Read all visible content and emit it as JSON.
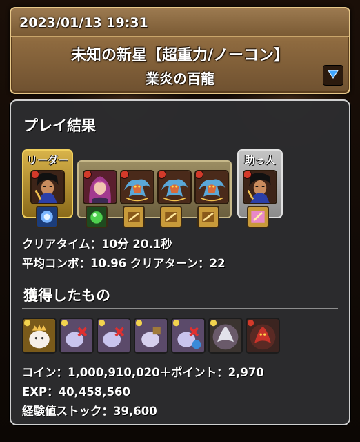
{
  "header": {
    "date": "2023/01/13 19:31",
    "title": "未知の新星【超重力/ノーコン】",
    "subtitle": "業炎の百龍",
    "expand_icon": "chevron-down-icon"
  },
  "play_result": {
    "heading": "プレイ結果",
    "leader_label": "リーダー",
    "helper_label": "助っ人",
    "team": [
      {
        "role": "leader",
        "icon": "monster-dark-warrior-icon",
        "attribute_color": "#d33a2a",
        "assist_icon": "assist-blue-beast-icon"
      },
      {
        "role": "sub",
        "icon": "monster-purple-hair-girl-icon",
        "attribute_color": "#d33a2a",
        "assist_icon": "assist-green-orb-icon"
      },
      {
        "role": "sub",
        "icon": "monster-dragon-icon",
        "attribute_color": "#d33a2a",
        "assist_icon": "assist-weapon-card-icon"
      },
      {
        "role": "sub",
        "icon": "monster-dragon-icon",
        "attribute_color": "#d33a2a",
        "assist_icon": "assist-weapon-card-icon"
      },
      {
        "role": "sub",
        "icon": "monster-dragon-icon",
        "attribute_color": "#d33a2a",
        "assist_icon": "assist-weapon-card-icon"
      },
      {
        "role": "helper",
        "icon": "monster-dark-warrior-icon",
        "attribute_color": "#d33a2a",
        "assist_icon": "assist-pink-card-icon"
      }
    ],
    "clear_time": "クリアタイム：10分 20.1秒",
    "combo_and_turns": "平均コンボ：10.96  クリアターン：22"
  },
  "rewards": {
    "heading": "獲得したもの",
    "items": [
      {
        "icon": "reward-tama-king-icon"
      },
      {
        "icon": "reward-crossed-card-icon"
      },
      {
        "icon": "reward-crossed-card-icon"
      },
      {
        "icon": "reward-card-icon"
      },
      {
        "icon": "reward-crossed-card-icon"
      },
      {
        "icon": "reward-silver-dragon-icon"
      },
      {
        "icon": "reward-fire-dragon-icon"
      }
    ],
    "coin_line": "コイン：1,000,910,020＋ポイント：2,970",
    "exp_line": "EXP：40,458,560",
    "stock_line": "経験値ストック：39,600"
  },
  "colors": {
    "header_gold": "#b89060",
    "panel_bg": "#2c2c2e",
    "leader_gold": "#d8b34a",
    "helper_silver": "#c4c4c4",
    "fire_attribute": "#d33a2a"
  }
}
